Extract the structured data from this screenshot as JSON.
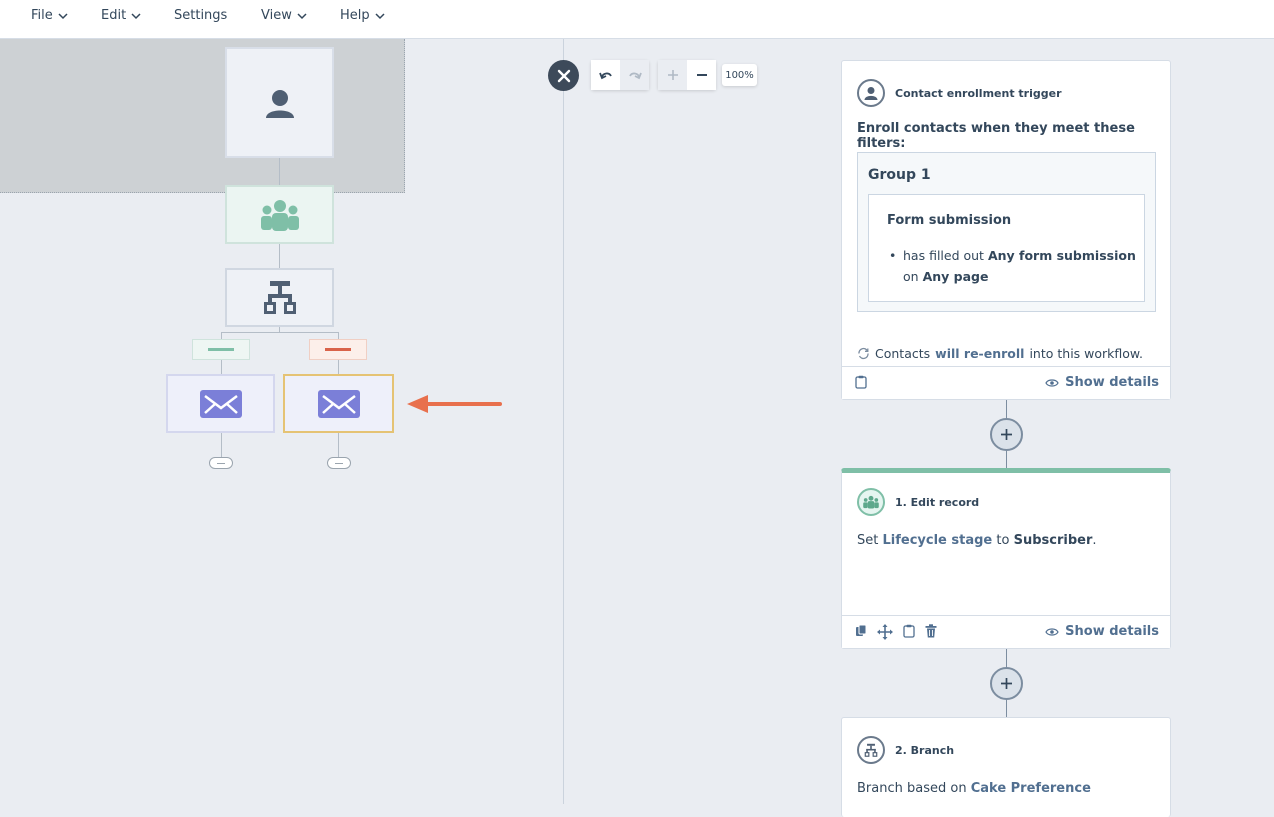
{
  "menu": {
    "items": [
      "File",
      "Edit",
      "Settings",
      "View",
      "Help"
    ]
  },
  "canvas": {
    "zoom_level": "100%"
  },
  "trigger_card": {
    "title": "Contact enrollment trigger",
    "subtitle": "Enroll contacts when they meet these filters:",
    "group_label": "Group 1",
    "filter_title": "Form submission",
    "filter_prefix": "has filled out",
    "filter_value": "Any form submission",
    "filter_on": "on",
    "filter_page": "Any page",
    "reenroll_prefix": "Contacts",
    "reenroll_highlight": "will re-enroll",
    "reenroll_suffix": "into this workflow.",
    "show_details": "Show details"
  },
  "edit_card": {
    "title": "1. Edit record",
    "text_prefix": "Set",
    "property": "Lifecycle stage",
    "text_mid": "to",
    "value": "Subscriber",
    "text_end": ".",
    "show_details": "Show details",
    "accent_color": "#7fbfa7"
  },
  "branch_card": {
    "title": "2. Branch",
    "text_prefix": "Branch based on",
    "property": "Cake Preference"
  },
  "colors": {
    "arrow": "#e8704d",
    "selected_node_border": "#e5c374",
    "email_icon": "#7b7fd8",
    "people_icon": "#7fbfa7"
  }
}
